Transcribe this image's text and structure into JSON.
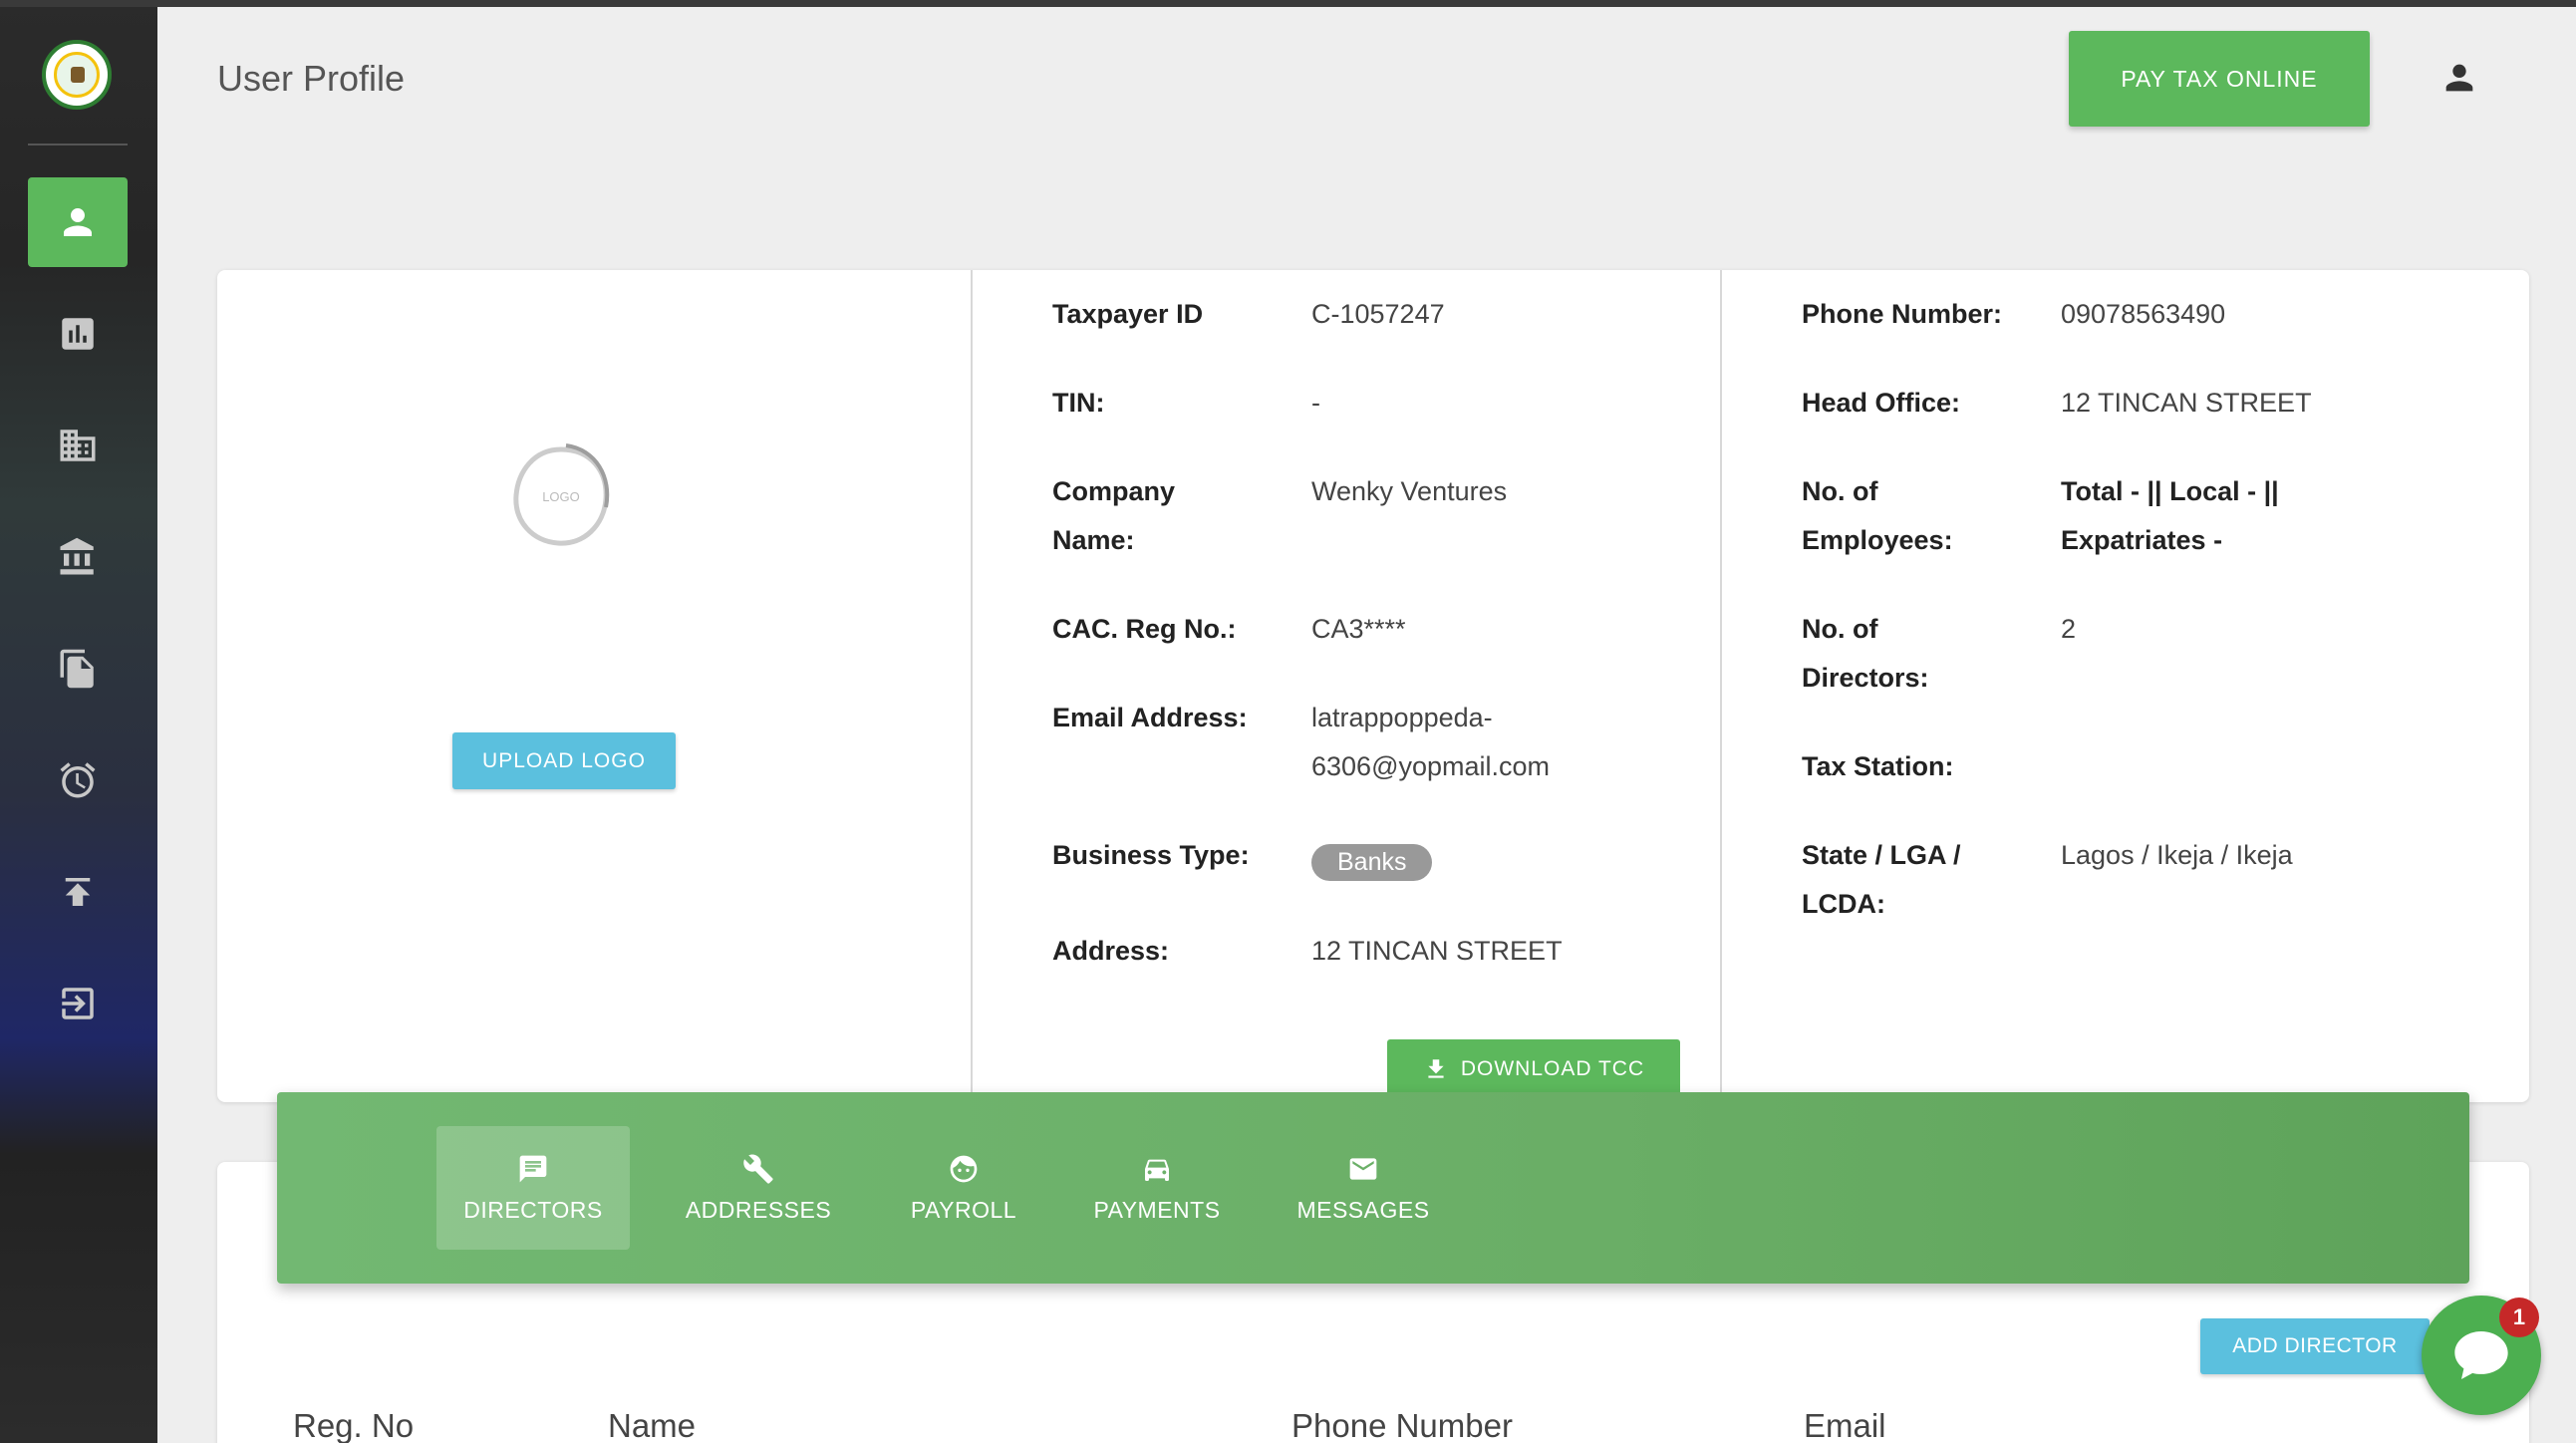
{
  "header": {
    "title": "User Profile",
    "pay_button": "PAY TAX ONLINE"
  },
  "sidebar": {
    "items": [
      {
        "icon": "person-icon",
        "active": true
      },
      {
        "icon": "bar-chart-icon"
      },
      {
        "icon": "building-icon"
      },
      {
        "icon": "bank-icon"
      },
      {
        "icon": "documents-icon"
      },
      {
        "icon": "alarm-clock-icon"
      },
      {
        "icon": "upload-icon"
      },
      {
        "icon": "logout-icon"
      }
    ]
  },
  "logo_panel": {
    "logo_text": "LOGO",
    "upload_button": "UPLOAD LOGO"
  },
  "details_left": {
    "taxpayer_id_label": "Taxpayer ID",
    "taxpayer_id": "C-1057247",
    "tin_label": "TIN:",
    "tin": "-",
    "company_name_label_1": "Company",
    "company_name_label_2": "Name:",
    "company_name": "Wenky Ventures",
    "cac_label": "CAC. Reg No.:",
    "cac": "CA3****",
    "email_label": "Email Address:",
    "email_1": "latrappoppeda-",
    "email_2": "6306@yopmail.com",
    "business_type_label": "Business Type:",
    "business_type": "Banks",
    "address_label": "Address:",
    "address": "12 TINCAN STREET",
    "download_button": "DOWNLOAD TCC"
  },
  "details_right": {
    "phone_label": "Phone Number:",
    "phone": "09078563490",
    "head_office_label": "Head Office:",
    "head_office": "12 TINCAN STREET",
    "employees_label_1": "No. of",
    "employees_label_2": "Employees:",
    "employees_1": "Total - || Local - ||",
    "employees_2": "Expatriates -",
    "directors_label_1": "No. of",
    "directors_label_2": "Directors:",
    "directors": "2",
    "tax_station_label": "Tax Station:",
    "state_label_1": "State / LGA /",
    "state_label_2": "LCDA:",
    "state": "Lagos / Ikeja / Ikeja"
  },
  "tabs": [
    {
      "label": "DIRECTORS",
      "icon": "chat-icon",
      "active": true
    },
    {
      "label": "ADDRESSES",
      "icon": "wrench-icon"
    },
    {
      "label": "PAYROLL",
      "icon": "face-icon"
    },
    {
      "label": "PAYMENTS",
      "icon": "car-icon"
    },
    {
      "label": "MESSAGES",
      "icon": "mail-icon"
    }
  ],
  "directors": {
    "add_button": "ADD DIRECTOR",
    "columns": [
      "Reg. No",
      "Name",
      "Phone Number",
      "Email"
    ]
  },
  "chat": {
    "unread_count": "1"
  },
  "colors": {
    "accent_green": "#5cb85c",
    "info_blue": "#5bc0de",
    "sidebar_dark": "#2b2b2b",
    "badge_red": "#c62828"
  }
}
